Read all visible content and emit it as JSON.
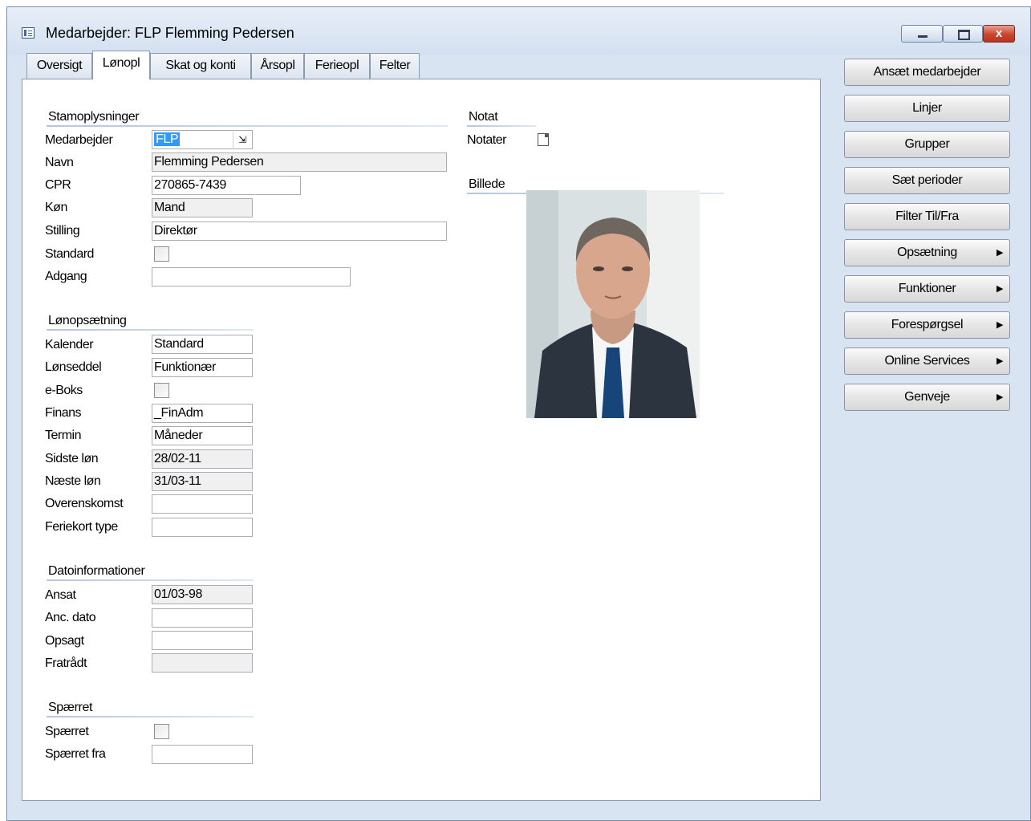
{
  "window": {
    "title": "Medarbejder: FLP  Flemming Pedersen",
    "close_glyph": "x"
  },
  "tabs": [
    {
      "label": "Oversigt"
    },
    {
      "label": "Lønopl"
    },
    {
      "label": "Skat og konti"
    },
    {
      "label": "Årsopl"
    },
    {
      "label": "Ferieopl"
    },
    {
      "label": "Felter"
    }
  ],
  "active_tab": "Lønopl",
  "stamoplysninger": {
    "heading": "Stamoplysninger",
    "medarbejder": {
      "label": "Medarbejder",
      "value": "FLP"
    },
    "navn": {
      "label": "Navn",
      "value": "Flemming Pedersen"
    },
    "cpr": {
      "label": "CPR",
      "value": "270865-7439"
    },
    "kon": {
      "label": "Køn",
      "value": "Mand"
    },
    "stilling": {
      "label": "Stilling",
      "value": "Direktør"
    },
    "standard": {
      "label": "Standard",
      "checked": false
    },
    "adgang": {
      "label": "Adgang",
      "value": ""
    }
  },
  "lonopsaetning": {
    "heading": "Lønopsætning",
    "kalender": {
      "label": "Kalender",
      "value": "Standard"
    },
    "lonseddel": {
      "label": "Lønseddel",
      "value": "Funktionær"
    },
    "eboks": {
      "label": "e-Boks",
      "checked": false
    },
    "finans": {
      "label": "Finans",
      "value": "_FinAdm"
    },
    "termin": {
      "label": "Termin",
      "value": "Måneder"
    },
    "sidste_lon": {
      "label": "Sidste løn",
      "value": "28/02-11"
    },
    "naeste_lon": {
      "label": "Næste løn",
      "value": "31/03-11"
    },
    "overenskomst": {
      "label": "Overenskomst",
      "value": ""
    },
    "feriekort": {
      "label": "Feriekort type",
      "value": ""
    }
  },
  "datoinformationer": {
    "heading": "Datoinformationer",
    "ansat": {
      "label": "Ansat",
      "value": "01/03-98"
    },
    "anc_dato": {
      "label": "Anc. dato",
      "value": ""
    },
    "opsagt": {
      "label": "Opsagt",
      "value": ""
    },
    "fratradt": {
      "label": "Fratrådt",
      "value": ""
    }
  },
  "spaerret": {
    "heading": "Spærret",
    "spaerret": {
      "label": "Spærret",
      "checked": false
    },
    "spaerret_fra": {
      "label": "Spærret fra",
      "value": ""
    }
  },
  "notat": {
    "heading": "Notat",
    "notater_label": "Notater"
  },
  "billede": {
    "heading": "Billede"
  },
  "side_buttons": [
    {
      "label": "Ansæt medarbejder",
      "submenu": false
    },
    {
      "label": "Linjer",
      "submenu": false
    },
    {
      "label": "Grupper",
      "submenu": false
    },
    {
      "label": "Sæt perioder",
      "submenu": false
    },
    {
      "label": "Filter Til/Fra",
      "submenu": false
    },
    {
      "label": "Opsætning",
      "submenu": true
    },
    {
      "label": "Funktioner",
      "submenu": true
    },
    {
      "label": "Forespørgsel",
      "submenu": true
    },
    {
      "label": "Online Services",
      "submenu": true
    },
    {
      "label": "Genveje",
      "submenu": true
    }
  ],
  "submenu_arrow": "▶",
  "colors": {
    "window_bg": "#d8e4f2",
    "selection": "#3399ff",
    "close_button": "#c9452f"
  }
}
